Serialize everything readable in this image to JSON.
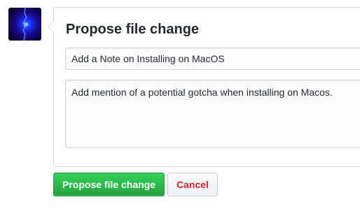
{
  "avatar": {
    "icon": "user-avatar-image"
  },
  "form": {
    "title": "Propose file change",
    "summary_value": "Add a Note on Installing on MacOS",
    "description_value": "Add mention of a potential gotcha when installing on Macos."
  },
  "actions": {
    "propose_label": "Propose file change",
    "cancel_label": "Cancel"
  },
  "colors": {
    "primary_button": "#28a745",
    "cancel_text": "#cb2431",
    "border": "#d1d5da"
  }
}
